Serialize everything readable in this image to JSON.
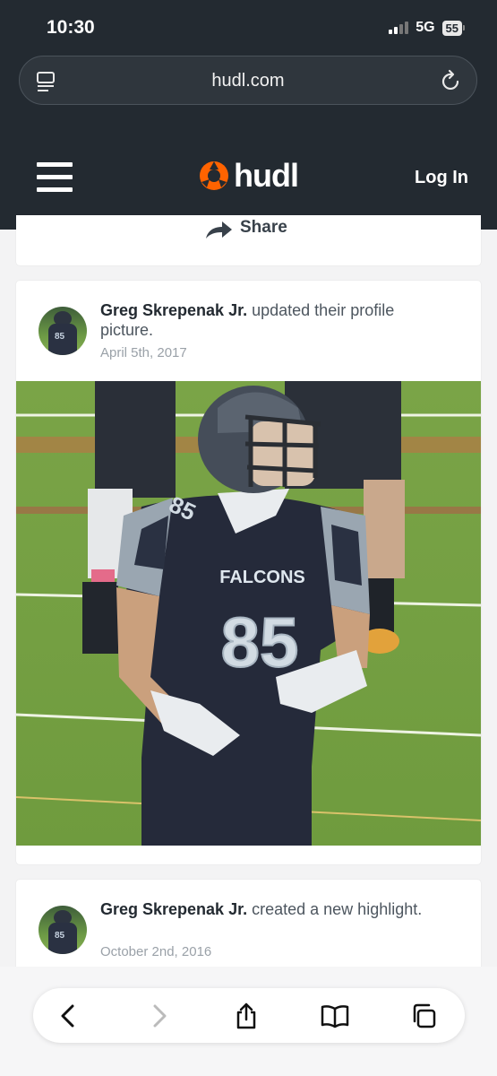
{
  "status": {
    "time": "10:30",
    "network": "5G",
    "battery": "55"
  },
  "browser": {
    "url": "hudl.com"
  },
  "header": {
    "brand": "hudl",
    "login_label": "Log In"
  },
  "share_card": {
    "share_label": "Share"
  },
  "posts": [
    {
      "author": "Greg Skrepenak Jr.",
      "action": "updated their profile picture.",
      "date": "April 5th, 2017"
    },
    {
      "author": "Greg Skrepenak Jr.",
      "action": "created a new highlight.",
      "date": "October 2nd, 2016"
    }
  ],
  "photo": {
    "jersey_text": "FALCONS",
    "jersey_number": "85"
  },
  "avatar_number": "85",
  "colors": {
    "header_bg": "#232a31",
    "brand_orange": "#ff6300",
    "background": "#f3f3f4"
  },
  "icons": {
    "tabs": "tab-overview-icon",
    "reload": "reload-icon",
    "menu": "hamburger-menu-icon",
    "share": "share-arrow-icon",
    "back": "chevron-left-icon",
    "forward": "chevron-right-icon",
    "share_sheet": "share-upload-icon",
    "bookmarks": "open-book-icon",
    "tabs_switcher": "tabs-icon"
  }
}
